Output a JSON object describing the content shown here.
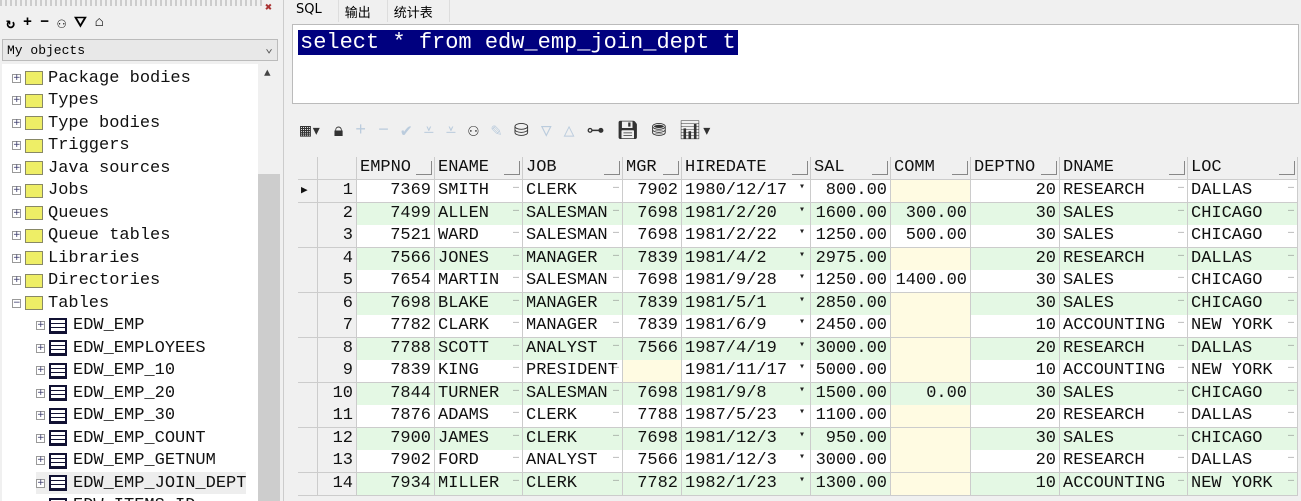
{
  "left_panel": {
    "toolbar_icons": [
      "refresh-icon",
      "plus-icon",
      "minus-icon",
      "binoculars-icon",
      "filter-icon",
      "filter-clear-icon"
    ],
    "filter_select": "My objects",
    "tree": [
      {
        "label": "Package bodies",
        "type": "folder"
      },
      {
        "label": "Types",
        "type": "folder"
      },
      {
        "label": "Type bodies",
        "type": "folder"
      },
      {
        "label": "Triggers",
        "type": "folder"
      },
      {
        "label": "Java sources",
        "type": "folder"
      },
      {
        "label": "Jobs",
        "type": "folder"
      },
      {
        "label": "Queues",
        "type": "folder"
      },
      {
        "label": "Queue tables",
        "type": "folder"
      },
      {
        "label": "Libraries",
        "type": "folder"
      },
      {
        "label": "Directories",
        "type": "folder"
      },
      {
        "label": "Tables",
        "type": "folder",
        "expanded": true
      },
      {
        "label": "EDW_EMP",
        "type": "table"
      },
      {
        "label": "EDW_EMPLOYEES",
        "type": "table"
      },
      {
        "label": "EDW_EMP_10",
        "type": "table"
      },
      {
        "label": "EDW_EMP_20",
        "type": "table"
      },
      {
        "label": "EDW_EMP_30",
        "type": "table"
      },
      {
        "label": "EDW_EMP_COUNT",
        "type": "table"
      },
      {
        "label": "EDW_EMP_GETNUM",
        "type": "table"
      },
      {
        "label": "EDW_EMP_JOIN_DEPT",
        "type": "table",
        "selected": true
      },
      {
        "label": "EDW_ITEMS_ID",
        "type": "table"
      }
    ]
  },
  "tabs": [
    {
      "label": "SQL",
      "active": true
    },
    {
      "label": "输出"
    },
    {
      "label": "统计表"
    }
  ],
  "sql": "select * from edw_emp_join_dept t",
  "grid": {
    "columns": [
      "EMPNO",
      "ENAME",
      "JOB",
      "MGR",
      "HIREDATE",
      "SAL",
      "COMM",
      "DEPTNO",
      "DNAME",
      "LOC"
    ],
    "rows": [
      [
        "7369",
        "SMITH",
        "CLERK",
        "7902",
        "1980/12/17",
        "800.00",
        "",
        "20",
        "RESEARCH",
        "DALLAS"
      ],
      [
        "7499",
        "ALLEN",
        "SALESMAN",
        "7698",
        "1981/2/20",
        "1600.00",
        "300.00",
        "30",
        "SALES",
        "CHICAGO"
      ],
      [
        "7521",
        "WARD",
        "SALESMAN",
        "7698",
        "1981/2/22",
        "1250.00",
        "500.00",
        "30",
        "SALES",
        "CHICAGO"
      ],
      [
        "7566",
        "JONES",
        "MANAGER",
        "7839",
        "1981/4/2",
        "2975.00",
        "",
        "20",
        "RESEARCH",
        "DALLAS"
      ],
      [
        "7654",
        "MARTIN",
        "SALESMAN",
        "7698",
        "1981/9/28",
        "1250.00",
        "1400.00",
        "30",
        "SALES",
        "CHICAGO"
      ],
      [
        "7698",
        "BLAKE",
        "MANAGER",
        "7839",
        "1981/5/1",
        "2850.00",
        "",
        "30",
        "SALES",
        "CHICAGO"
      ],
      [
        "7782",
        "CLARK",
        "MANAGER",
        "7839",
        "1981/6/9",
        "2450.00",
        "",
        "10",
        "ACCOUNTING",
        "NEW YORK"
      ],
      [
        "7788",
        "SCOTT",
        "ANALYST",
        "7566",
        "1987/4/19",
        "3000.00",
        "",
        "20",
        "RESEARCH",
        "DALLAS"
      ],
      [
        "7839",
        "KING",
        "PRESIDENT",
        "",
        "1981/11/17",
        "5000.00",
        "",
        "10",
        "ACCOUNTING",
        "NEW YORK"
      ],
      [
        "7844",
        "TURNER",
        "SALESMAN",
        "7698",
        "1981/9/8",
        "1500.00",
        "0.00",
        "30",
        "SALES",
        "CHICAGO"
      ],
      [
        "7876",
        "ADAMS",
        "CLERK",
        "7788",
        "1987/5/23",
        "1100.00",
        "",
        "20",
        "RESEARCH",
        "DALLAS"
      ],
      [
        "7900",
        "JAMES",
        "CLERK",
        "7698",
        "1981/12/3",
        "950.00",
        "",
        "30",
        "SALES",
        "CHICAGO"
      ],
      [
        "7902",
        "FORD",
        "ANALYST",
        "7566",
        "1981/12/3",
        "3000.00",
        "",
        "20",
        "RESEARCH",
        "DALLAS"
      ],
      [
        "7934",
        "MILLER",
        "CLERK",
        "7782",
        "1982/1/23",
        "1300.00",
        "",
        "10",
        "ACCOUNTING",
        "NEW YORK"
      ]
    ]
  },
  "colors": {
    "selection": "#00007f",
    "row_alt": "#e4f8e4",
    "null_cell": "#fffbe2"
  }
}
